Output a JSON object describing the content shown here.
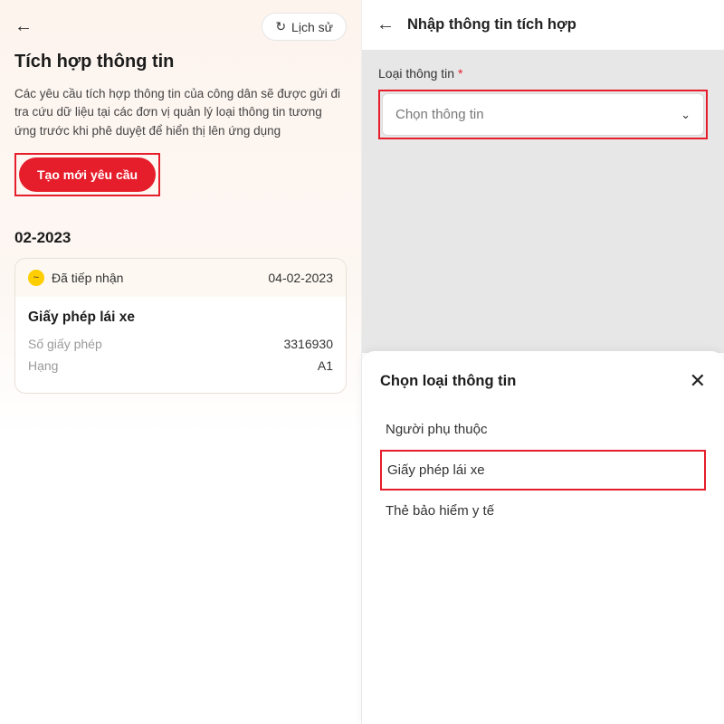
{
  "left": {
    "history_label": "Lịch sử",
    "title": "Tích hợp thông tin",
    "description": "Các yêu cầu tích hợp thông tin của công dân sẽ được gửi đi tra cứu dữ liệu tại các đơn vị quản lý loại thông tin tương ứng trước khi phê duyệt để hiển thị lên ứng dụng",
    "create_label": "Tạo mới yêu cầu",
    "month": "02-2023",
    "card": {
      "status": "Đã tiếp nhận",
      "date": "04-02-2023",
      "doc_title": "Giấy phép lái xe",
      "license_no_label": "Số giấy phép",
      "license_no": "3316930",
      "class_label": "Hạng",
      "class": "A1"
    }
  },
  "right": {
    "title": "Nhập thông tin tích hợp",
    "field_label": "Loại thông tin",
    "select_placeholder": "Chọn thông tin",
    "sheet_title": "Chọn loại thông tin",
    "options": {
      "o1": "Người phụ thuộc",
      "o2": "Giấy phép lái xe",
      "o3": "Thẻ bảo hiểm y tế"
    }
  }
}
